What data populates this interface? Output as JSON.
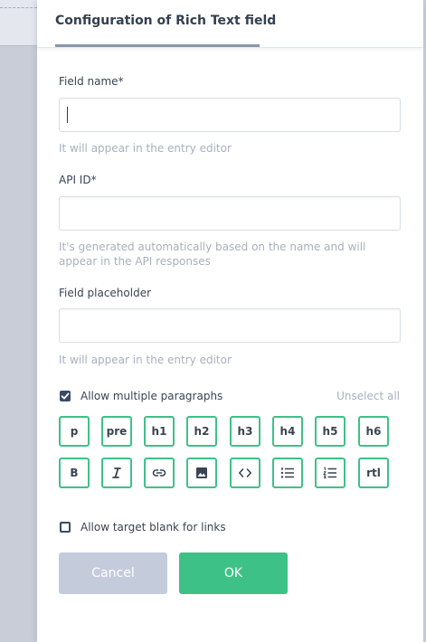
{
  "header": {
    "title": "Configuration of Rich Text field"
  },
  "fields": {
    "name": {
      "label": "Field name*",
      "value": "",
      "hint": "It will appear in the entry editor"
    },
    "api_id": {
      "label": "API ID*",
      "value": "",
      "hint": "It's generated automatically based on the name and will appear in the API responses"
    },
    "placeholder": {
      "label": "Field placeholder",
      "value": "",
      "hint": "It will appear in the entry editor"
    }
  },
  "options": {
    "multiple_paragraphs": {
      "label": "Allow multiple paragraphs",
      "checked": true
    },
    "unselect_all": "Unselect all",
    "format_buttons_row1": [
      "p",
      "pre",
      "h1",
      "h2",
      "h3",
      "h4",
      "h5",
      "h6"
    ],
    "format_buttons_row2": [
      {
        "type": "text",
        "label": "B",
        "name": "bold"
      },
      {
        "type": "icon",
        "icon": "italic-icon",
        "name": "italic"
      },
      {
        "type": "icon",
        "icon": "link-icon",
        "name": "link"
      },
      {
        "type": "icon",
        "icon": "image-icon",
        "name": "image"
      },
      {
        "type": "icon",
        "icon": "code-icon",
        "name": "code"
      },
      {
        "type": "icon",
        "icon": "bullet-list-icon",
        "name": "bullet-list"
      },
      {
        "type": "icon",
        "icon": "numbered-list-icon",
        "name": "numbered-list"
      },
      {
        "type": "text",
        "label": "rtl",
        "name": "rtl"
      }
    ],
    "target_blank": {
      "label": "Allow target blank for links",
      "checked": false
    }
  },
  "actions": {
    "cancel_label": "Cancel",
    "ok_label": "OK"
  },
  "colors": {
    "accent": "#3ec187",
    "cancel_bg": "#c4ccdc",
    "text": "#3a4452",
    "muted": "#a8b0bd"
  }
}
